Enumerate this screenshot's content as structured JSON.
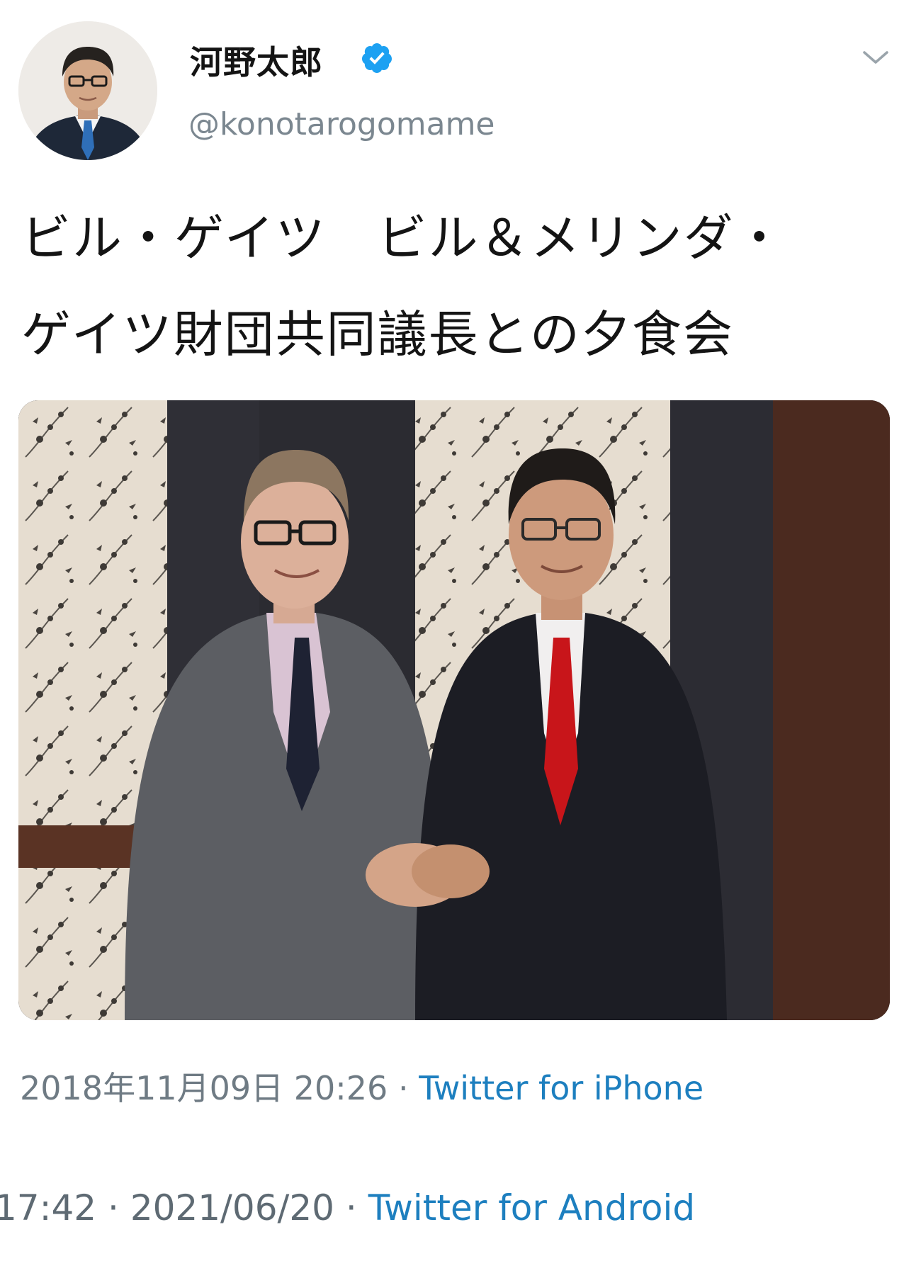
{
  "tweet": {
    "author": {
      "display_name": "河野太郎",
      "handle": "@konotarogomame",
      "verified": true,
      "avatar_icon": "profile-photo"
    },
    "menu_icon": "chevron-down-icon",
    "text_lines": [
      "ビル・ゲイツ　ビル＆メリンダ・",
      "ゲイツ財団共同議長との夕食会"
    ],
    "timestamp": "2018年11月09日 20:26",
    "separator": "·",
    "source": "Twitter for iPhone"
  },
  "retweet_meta": {
    "time": "17:42",
    "date": "2021/06/20",
    "separator": "·",
    "source": "Twitter for Android"
  },
  "colors": {
    "verified_blue": "#1da1f2",
    "link_blue": "#1d7fbf",
    "meta_gray": "#6f7b84"
  }
}
